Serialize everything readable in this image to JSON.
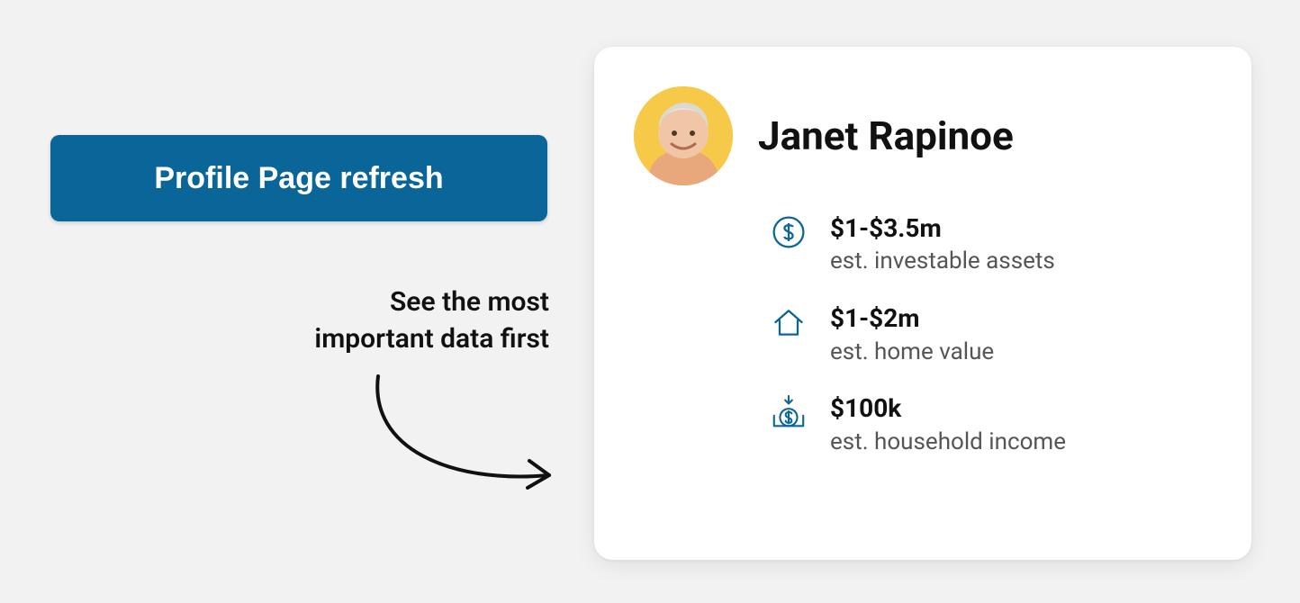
{
  "button_label": "Profile Page refresh",
  "tagline_line1": "See the most",
  "tagline_line2": "important data first",
  "profile": {
    "name": "Janet Rapinoe",
    "stats": [
      {
        "icon": "dollar-circle-icon",
        "value": "$1-$3.5m",
        "label": "est. investable assets"
      },
      {
        "icon": "home-icon",
        "value": "$1-$2m",
        "label": "est. home value"
      },
      {
        "icon": "income-icon",
        "value": "$100k",
        "label": "est. household income"
      }
    ]
  }
}
